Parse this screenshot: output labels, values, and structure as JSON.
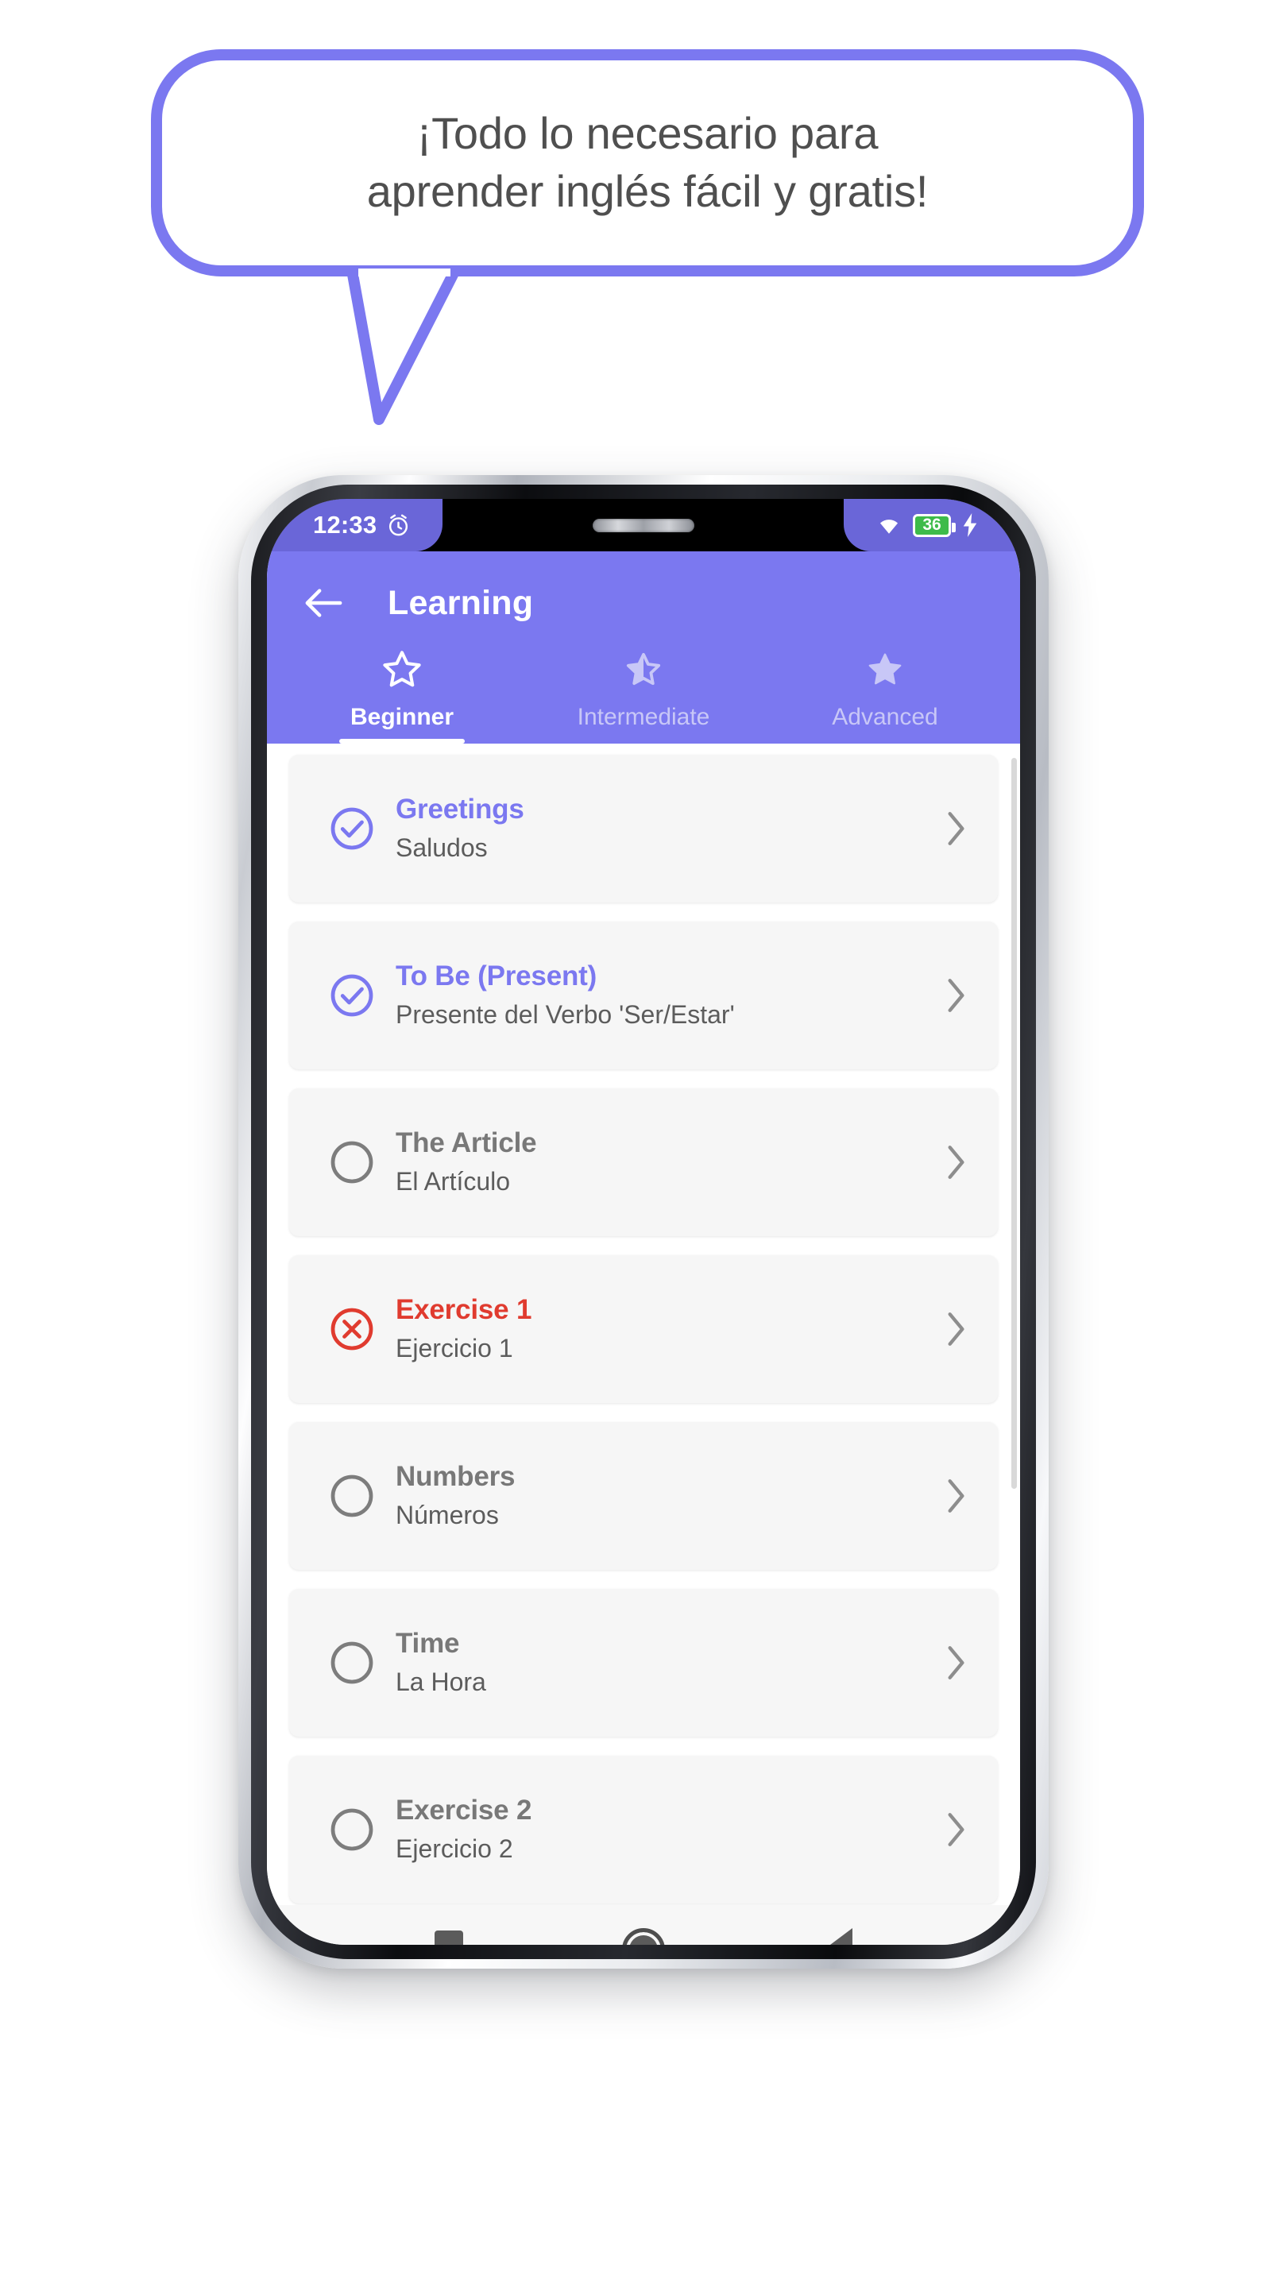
{
  "promo": {
    "bubble_text": "¡Todo lo necesario para\naprender inglés fácil y gratis!",
    "bubble_border_color": "#7b78f0",
    "bubble_text_color": "#4f4f4f"
  },
  "status_bar": {
    "time": "12:33",
    "alarm_icon": "alarm-icon",
    "wifi_icon": "wifi-icon",
    "battery_level": "36",
    "battery_color": "#3dbb4a",
    "charging_icon": "charging-bolt-icon"
  },
  "app_bar": {
    "back_icon": "back-arrow-icon",
    "title": "Learning",
    "background_color": "#7b78f0"
  },
  "tabs": [
    {
      "label": "Beginner",
      "icon": "star-outline-icon",
      "active": true
    },
    {
      "label": "Intermediate",
      "icon": "star-half-icon",
      "active": false
    },
    {
      "label": "Advanced",
      "icon": "star-filled-icon",
      "active": false
    }
  ],
  "lessons": [
    {
      "title": "Greetings",
      "subtitle": "Saludos",
      "status": "done",
      "status_icon": "check-circle-icon",
      "chevron_icon": "chevron-right-icon"
    },
    {
      "title": "To Be (Present)",
      "subtitle": "Presente del Verbo 'Ser/Estar'",
      "status": "done",
      "status_icon": "check-circle-icon",
      "chevron_icon": "chevron-right-icon"
    },
    {
      "title": "The Article",
      "subtitle": "El Artículo",
      "status": "todo",
      "status_icon": "empty-circle-icon",
      "chevron_icon": "chevron-right-icon"
    },
    {
      "title": "Exercise 1",
      "subtitle": "Ejercicio 1",
      "status": "fail",
      "status_icon": "x-circle-icon",
      "chevron_icon": "chevron-right-icon"
    },
    {
      "title": "Numbers",
      "subtitle": "Números",
      "status": "todo",
      "status_icon": "empty-circle-icon",
      "chevron_icon": "chevron-right-icon"
    },
    {
      "title": "Time",
      "subtitle": "La Hora",
      "status": "todo",
      "status_icon": "empty-circle-icon",
      "chevron_icon": "chevron-right-icon"
    },
    {
      "title": "Exercise 2",
      "subtitle": "Ejercicio 2",
      "status": "todo",
      "status_icon": "empty-circle-icon",
      "chevron_icon": "chevron-right-icon"
    }
  ],
  "nav_bar": {
    "recents_icon": "square-recents-icon",
    "home_icon": "circle-home-icon",
    "back_icon": "triangle-back-icon"
  },
  "colors": {
    "accent": "#7b78f0",
    "status_bar": "#6a66d8",
    "done": "#7b78f0",
    "todo": "#787878",
    "fail": "#e03b2f",
    "card_bg": "#f6f6f6"
  }
}
